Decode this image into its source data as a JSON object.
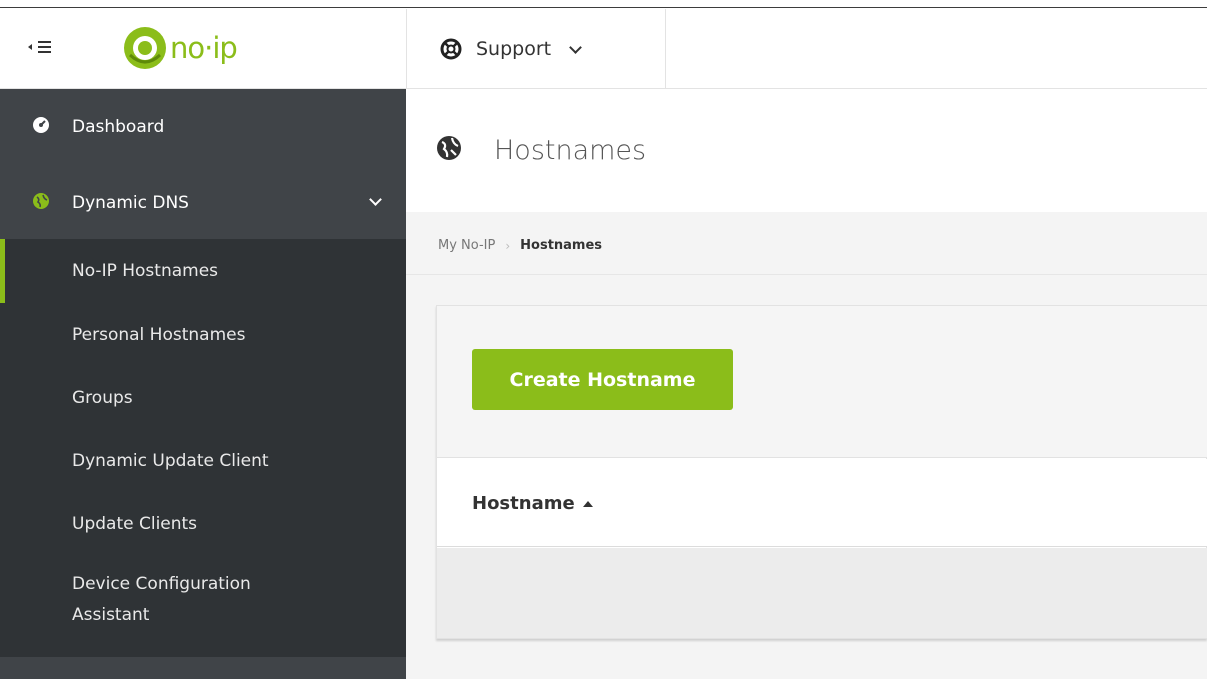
{
  "brand": {
    "logo_text": "no·ip",
    "accent": "#8bbd1a",
    "sidebar_bg": "#404448",
    "submenu_bg": "#2f3336"
  },
  "topbar": {
    "toggle_icon": "sidebar-toggle-icon",
    "support_label": "Support",
    "support_icon": "lifebuoy-icon"
  },
  "sidebar": {
    "items": [
      {
        "label": "Dashboard",
        "icon": "dashboard-icon"
      },
      {
        "label": "Dynamic DNS",
        "icon": "globe-icon",
        "expanded": true
      }
    ],
    "submenu": [
      {
        "label": "No-IP Hostnames",
        "active": true
      },
      {
        "label": "Personal Hostnames"
      },
      {
        "label": "Groups"
      },
      {
        "label": "Dynamic Update Client"
      },
      {
        "label": "Update Clients"
      },
      {
        "label": "Device Configuration Assistant"
      }
    ]
  },
  "page": {
    "title": "Hostnames",
    "breadcrumb": [
      "My No-IP",
      "Hostnames"
    ],
    "create_button": "Create Hostname",
    "table": {
      "columns": [
        "Hostname"
      ],
      "sort": "ascending",
      "rows": []
    }
  }
}
